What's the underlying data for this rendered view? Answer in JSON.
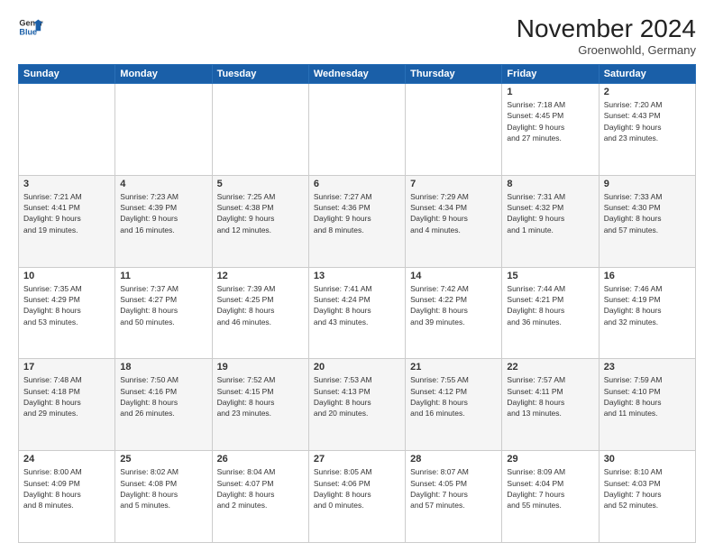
{
  "header": {
    "logo_text_general": "General",
    "logo_text_blue": "Blue",
    "month_title": "November 2024",
    "location": "Groenwohld, Germany"
  },
  "weekdays": [
    "Sunday",
    "Monday",
    "Tuesday",
    "Wednesday",
    "Thursday",
    "Friday",
    "Saturday"
  ],
  "weeks": [
    [
      {
        "day": "",
        "info": ""
      },
      {
        "day": "",
        "info": ""
      },
      {
        "day": "",
        "info": ""
      },
      {
        "day": "",
        "info": ""
      },
      {
        "day": "",
        "info": ""
      },
      {
        "day": "1",
        "info": "Sunrise: 7:18 AM\nSunset: 4:45 PM\nDaylight: 9 hours\nand 27 minutes."
      },
      {
        "day": "2",
        "info": "Sunrise: 7:20 AM\nSunset: 4:43 PM\nDaylight: 9 hours\nand 23 minutes."
      }
    ],
    [
      {
        "day": "3",
        "info": "Sunrise: 7:21 AM\nSunset: 4:41 PM\nDaylight: 9 hours\nand 19 minutes."
      },
      {
        "day": "4",
        "info": "Sunrise: 7:23 AM\nSunset: 4:39 PM\nDaylight: 9 hours\nand 16 minutes."
      },
      {
        "day": "5",
        "info": "Sunrise: 7:25 AM\nSunset: 4:38 PM\nDaylight: 9 hours\nand 12 minutes."
      },
      {
        "day": "6",
        "info": "Sunrise: 7:27 AM\nSunset: 4:36 PM\nDaylight: 9 hours\nand 8 minutes."
      },
      {
        "day": "7",
        "info": "Sunrise: 7:29 AM\nSunset: 4:34 PM\nDaylight: 9 hours\nand 4 minutes."
      },
      {
        "day": "8",
        "info": "Sunrise: 7:31 AM\nSunset: 4:32 PM\nDaylight: 9 hours\nand 1 minute."
      },
      {
        "day": "9",
        "info": "Sunrise: 7:33 AM\nSunset: 4:30 PM\nDaylight: 8 hours\nand 57 minutes."
      }
    ],
    [
      {
        "day": "10",
        "info": "Sunrise: 7:35 AM\nSunset: 4:29 PM\nDaylight: 8 hours\nand 53 minutes."
      },
      {
        "day": "11",
        "info": "Sunrise: 7:37 AM\nSunset: 4:27 PM\nDaylight: 8 hours\nand 50 minutes."
      },
      {
        "day": "12",
        "info": "Sunrise: 7:39 AM\nSunset: 4:25 PM\nDaylight: 8 hours\nand 46 minutes."
      },
      {
        "day": "13",
        "info": "Sunrise: 7:41 AM\nSunset: 4:24 PM\nDaylight: 8 hours\nand 43 minutes."
      },
      {
        "day": "14",
        "info": "Sunrise: 7:42 AM\nSunset: 4:22 PM\nDaylight: 8 hours\nand 39 minutes."
      },
      {
        "day": "15",
        "info": "Sunrise: 7:44 AM\nSunset: 4:21 PM\nDaylight: 8 hours\nand 36 minutes."
      },
      {
        "day": "16",
        "info": "Sunrise: 7:46 AM\nSunset: 4:19 PM\nDaylight: 8 hours\nand 32 minutes."
      }
    ],
    [
      {
        "day": "17",
        "info": "Sunrise: 7:48 AM\nSunset: 4:18 PM\nDaylight: 8 hours\nand 29 minutes."
      },
      {
        "day": "18",
        "info": "Sunrise: 7:50 AM\nSunset: 4:16 PM\nDaylight: 8 hours\nand 26 minutes."
      },
      {
        "day": "19",
        "info": "Sunrise: 7:52 AM\nSunset: 4:15 PM\nDaylight: 8 hours\nand 23 minutes."
      },
      {
        "day": "20",
        "info": "Sunrise: 7:53 AM\nSunset: 4:13 PM\nDaylight: 8 hours\nand 20 minutes."
      },
      {
        "day": "21",
        "info": "Sunrise: 7:55 AM\nSunset: 4:12 PM\nDaylight: 8 hours\nand 16 minutes."
      },
      {
        "day": "22",
        "info": "Sunrise: 7:57 AM\nSunset: 4:11 PM\nDaylight: 8 hours\nand 13 minutes."
      },
      {
        "day": "23",
        "info": "Sunrise: 7:59 AM\nSunset: 4:10 PM\nDaylight: 8 hours\nand 11 minutes."
      }
    ],
    [
      {
        "day": "24",
        "info": "Sunrise: 8:00 AM\nSunset: 4:09 PM\nDaylight: 8 hours\nand 8 minutes."
      },
      {
        "day": "25",
        "info": "Sunrise: 8:02 AM\nSunset: 4:08 PM\nDaylight: 8 hours\nand 5 minutes."
      },
      {
        "day": "26",
        "info": "Sunrise: 8:04 AM\nSunset: 4:07 PM\nDaylight: 8 hours\nand 2 minutes."
      },
      {
        "day": "27",
        "info": "Sunrise: 8:05 AM\nSunset: 4:06 PM\nDaylight: 8 hours\nand 0 minutes."
      },
      {
        "day": "28",
        "info": "Sunrise: 8:07 AM\nSunset: 4:05 PM\nDaylight: 7 hours\nand 57 minutes."
      },
      {
        "day": "29",
        "info": "Sunrise: 8:09 AM\nSunset: 4:04 PM\nDaylight: 7 hours\nand 55 minutes."
      },
      {
        "day": "30",
        "info": "Sunrise: 8:10 AM\nSunset: 4:03 PM\nDaylight: 7 hours\nand 52 minutes."
      }
    ]
  ]
}
